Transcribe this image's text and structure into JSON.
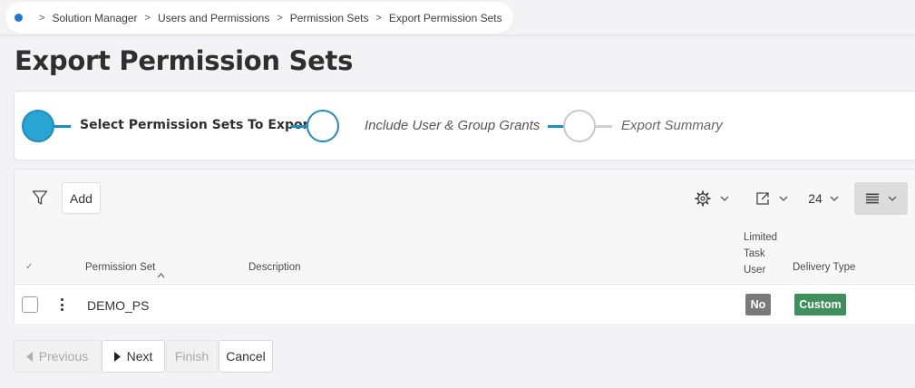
{
  "breadcrumb": {
    "items": [
      "Solution Manager",
      "Users and Permissions",
      "Permission Sets",
      "Export Permission Sets"
    ],
    "separator": ">"
  },
  "page": {
    "title": "Export Permission Sets"
  },
  "wizard": {
    "steps": [
      {
        "label": "Select Permission Sets To Export",
        "state": "current"
      },
      {
        "label": "Include User & Group Grants",
        "state": "next"
      },
      {
        "label": "Export Summary",
        "state": "upcoming"
      }
    ]
  },
  "toolbar": {
    "add_label": "Add",
    "rows_per_page": "24"
  },
  "table": {
    "columns": {
      "select": "✓",
      "permission_set": "Permission Set",
      "description": "Description",
      "limited_task_user": [
        "Limited",
        "Task",
        "User"
      ],
      "delivery_type": "Delivery Type"
    },
    "rows": [
      {
        "permission_set": "DEMO_PS",
        "description": "",
        "limited_task_user": "No",
        "delivery_type": "Custom"
      }
    ]
  },
  "footer": {
    "previous": "Previous",
    "next": "Next",
    "finish": "Finish",
    "cancel": "Cancel"
  },
  "colors": {
    "accent": "#1e8bc3",
    "step_current_fill": "#2aa4d2",
    "badge_no": "#7a7a7a",
    "badge_custom": "#3f8f5c"
  }
}
